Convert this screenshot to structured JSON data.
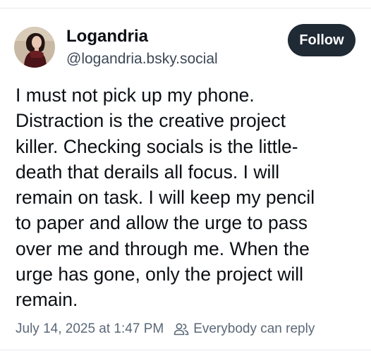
{
  "post": {
    "author": {
      "display_name": "Logandria",
      "handle": "@logandria.bsky.social"
    },
    "follow_label": "Follow",
    "text_lines": [
      "I must not pick up my phone.",
      "Distraction is the creative project",
      "killer. Checking socials is the little-",
      "death that derails all focus. I will",
      "remain on task. I will keep my pencil",
      "to paper and allow the urge to pass",
      "over me and through me. When the",
      "urge has gone, only the project will",
      "remain."
    ],
    "timestamp": "July 14, 2025 at 1:47 PM",
    "reply_setting": "Everybody can reply",
    "icons": {
      "avatar": "avatar",
      "reply_setting": "people-icon"
    }
  },
  "colors": {
    "follow_button_bg": "#202a35",
    "handle_text": "#3c4856",
    "meta_text": "#5b6877"
  }
}
